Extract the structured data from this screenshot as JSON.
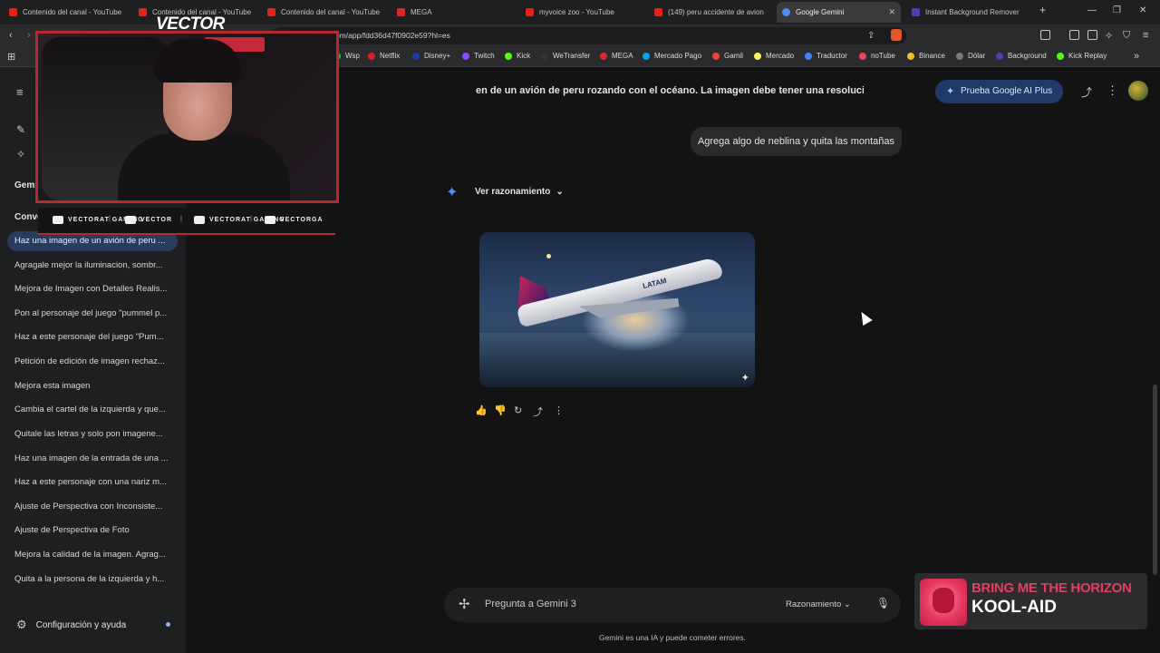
{
  "browser": {
    "tabs": [
      {
        "title": "Contenido del canal - YouTube",
        "color": "#e62117"
      },
      {
        "title": "Contenido del canal - YouTube",
        "color": "#e62117"
      },
      {
        "title": "Contenido del canal - YouTube",
        "color": "#e62117"
      },
      {
        "title": "MEGA",
        "color": "#d9272e"
      },
      {
        "title": "myvoice zoo - YouTube",
        "color": "#e62117"
      },
      {
        "title": "(149) peru accidente de avion",
        "color": "#e62117"
      },
      {
        "title": "Google Gemini",
        "color": "#4f8df5",
        "active": true
      },
      {
        "title": "Instant Background Remover",
        "color": "#4a3fb5"
      }
    ],
    "new_tab": "+",
    "url": "om/app/fdd36d47f0902e59?hl=es",
    "bookmarks": [
      {
        "label": "Wsp",
        "color": "#2bb741"
      },
      {
        "label": "Netflix",
        "color": "#d8202a"
      },
      {
        "label": "Disney+",
        "color": "#1e3ca8"
      },
      {
        "label": "Twitch",
        "color": "#9146ff"
      },
      {
        "label": "Kick",
        "color": "#53fc18"
      },
      {
        "label": "WeTransfer",
        "color": "#333333"
      },
      {
        "label": "MEGA",
        "color": "#d9272e"
      },
      {
        "label": "Mercado Pago",
        "color": "#00a6e8"
      },
      {
        "label": "Gamil",
        "color": "#ea4335"
      },
      {
        "label": "Mercado",
        "color": "#fff159"
      },
      {
        "label": "Traductor",
        "color": "#4285f4"
      },
      {
        "label": "noTube",
        "color": "#e94560"
      },
      {
        "label": "Binance",
        "color": "#f3ba2f"
      },
      {
        "label": "Dólar",
        "color": "#7a7a7a"
      },
      {
        "label": "Background",
        "color": "#4a3fb5"
      },
      {
        "label": "Kick Replay",
        "color": "#53fc18"
      }
    ]
  },
  "sidebar": {
    "gems_label": "Gems",
    "convs_label": "Conve",
    "conversations": [
      "Haz una imagen de un avión de peru ...",
      "Agragale mejor la iluminacion, sombr...",
      "Mejora de Imagen con Detalles Realis...",
      "Pon al personaje del juego \"pummel p...",
      "Haz a este personaje del juego \"Pum...",
      "Petición de edición de imagen rechaz...",
      "Mejora esta imagen",
      "Cambia el cartel de la izquierda y que...",
      "Quitale las letras y solo pon imagene...",
      "Haz una imagen de la entrada de una ...",
      "Haz a este personaje con una nariz m...",
      "Ajuste de Perspectiva con Inconsiste...",
      "Ajuste de Perspectiva de Foto",
      "Mejora la calidad de la imagen. Agrag...",
      "Quita a la persona de la izquierda y h..."
    ],
    "settings_label": "Configuración y ayuda"
  },
  "main": {
    "prompt_text": "en de un avión de peru rozando con el océano. La imagen debe tener una resolucion",
    "pro_button": "Prueba Google AI Plus",
    "user_message": "Agrega algo de neblina y quita las montañas",
    "reasoning_toggle": "Ver razonamiento",
    "image_brand": "LATAM",
    "input_placeholder": "Pregunta a Gemini 3",
    "mode_label": "Razonamiento",
    "disclaimer": "Gemini es una IA y puede cometer errores."
  },
  "overlay": {
    "logo": "VECTOR",
    "socials": [
      "VECTORAT GAMING",
      "VECTOR",
      "VECTORAT GAMING",
      "VECTORGA"
    ],
    "separator": "|"
  },
  "now_playing": {
    "artist": "BRING ME THE HORIZON",
    "song": "KOOL-AID"
  }
}
